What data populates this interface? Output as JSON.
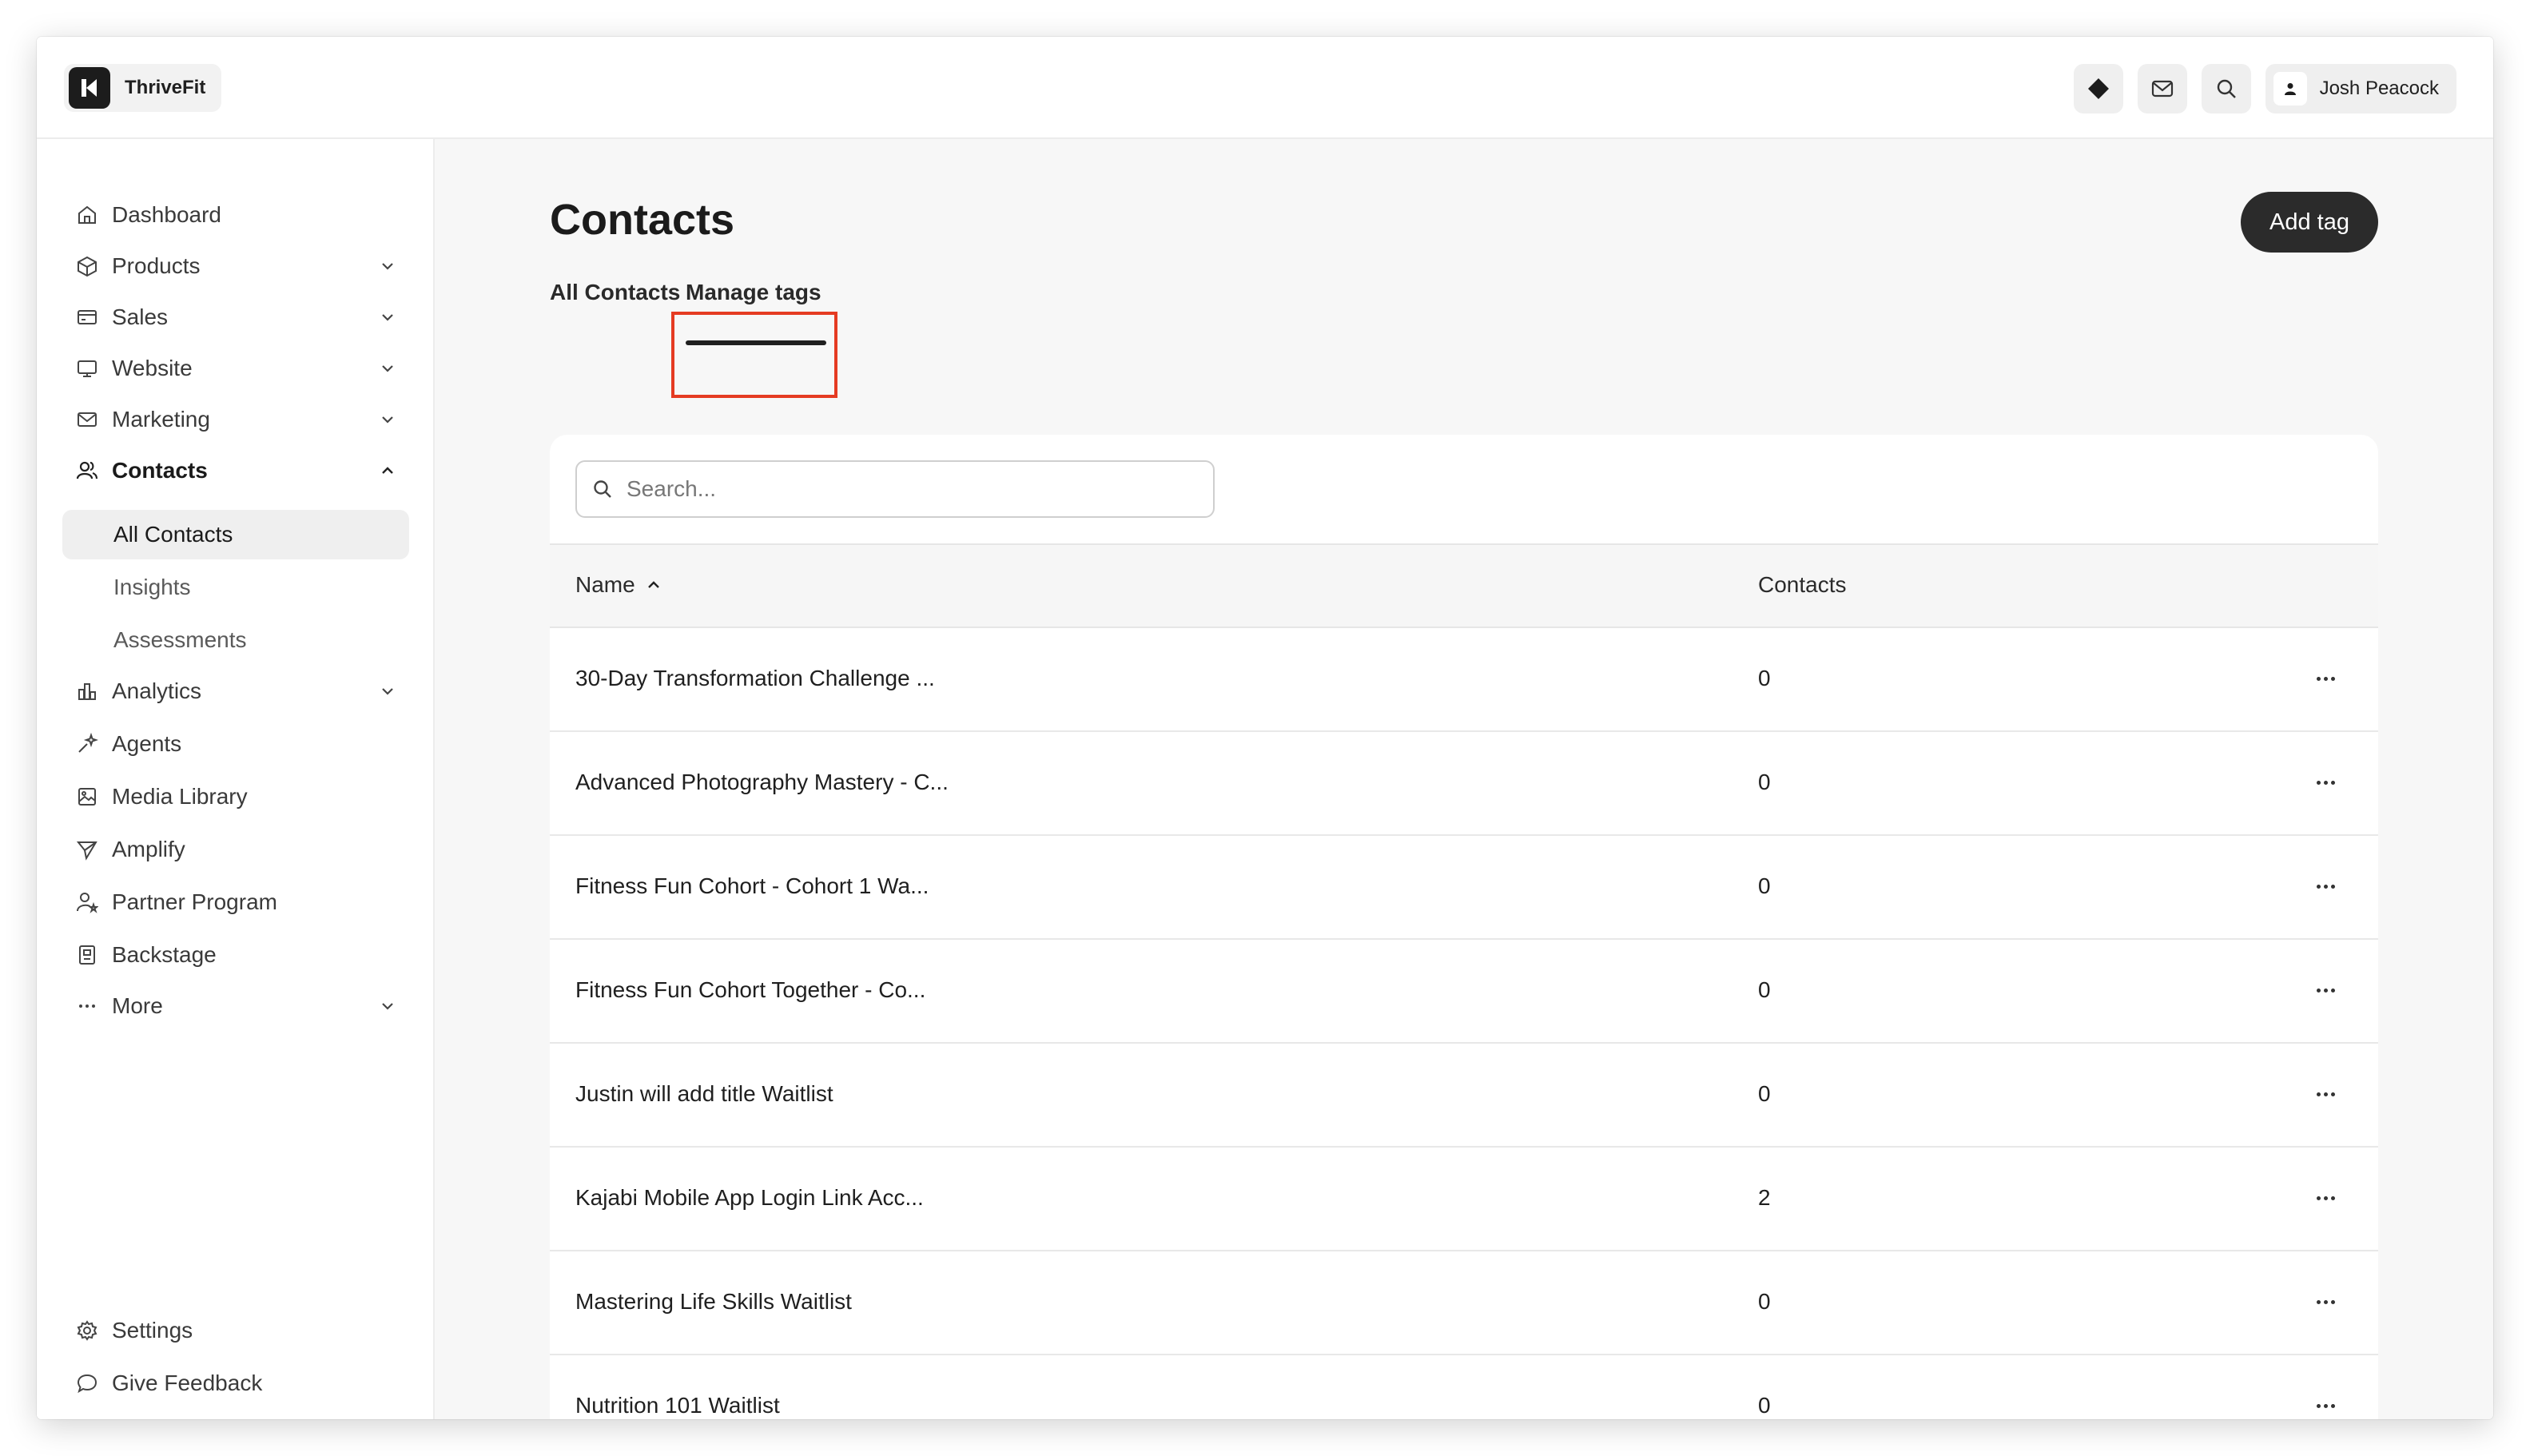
{
  "app": {
    "name": "ThriveFit"
  },
  "topbar": {
    "user_name": "Josh Peacock",
    "icons": [
      "diamond-icon",
      "mail-icon",
      "search-icon",
      "user-icon"
    ]
  },
  "sidebar": {
    "items": [
      {
        "label": "Dashboard",
        "icon": "home-icon"
      },
      {
        "label": "Products",
        "icon": "box-icon"
      },
      {
        "label": "Sales",
        "icon": "credit-card-icon"
      },
      {
        "label": "Website",
        "icon": "monitor-icon"
      },
      {
        "label": "Marketing",
        "icon": "mail-icon"
      },
      {
        "label": "Contacts",
        "icon": "users-icon"
      },
      {
        "label": "Analytics",
        "icon": "bar-chart-icon"
      },
      {
        "label": "Agents",
        "icon": "sparkle-icon"
      },
      {
        "label": "Media Library",
        "icon": "image-icon"
      },
      {
        "label": "Amplify",
        "icon": "send-icon"
      },
      {
        "label": "Partner Program",
        "icon": "user-star-icon"
      },
      {
        "label": "Backstage",
        "icon": "badge-icon"
      },
      {
        "label": "More",
        "icon": "dots-icon"
      }
    ],
    "contacts_sub": [
      {
        "label": "All Contacts",
        "active": true
      },
      {
        "label": "Insights"
      },
      {
        "label": "Assessments"
      }
    ],
    "footer": [
      {
        "label": "Settings",
        "icon": "gear-icon"
      },
      {
        "label": "Give Feedback",
        "icon": "message-icon"
      }
    ]
  },
  "main": {
    "title": "Contacts",
    "add_button": "Add tag",
    "tabs": [
      {
        "label": "All Contacts"
      },
      {
        "label": "Manage tags",
        "active": true
      }
    ],
    "search_placeholder": "Search...",
    "columns": {
      "name": "Name",
      "contacts": "Contacts"
    },
    "rows": [
      {
        "name": "30-Day Transformation Challenge ...",
        "contacts": "0"
      },
      {
        "name": "Advanced Photography Mastery - C...",
        "contacts": "0"
      },
      {
        "name": "Fitness Fun Cohort - Cohort 1 Wa...",
        "contacts": "0"
      },
      {
        "name": "Fitness Fun Cohort Together - Co...",
        "contacts": "0"
      },
      {
        "name": "Justin will add title Waitlist",
        "contacts": "0"
      },
      {
        "name": "Kajabi Mobile App Login Link Acc...",
        "contacts": "2"
      },
      {
        "name": "Mastering Life Skills Waitlist",
        "contacts": "0"
      },
      {
        "name": "Nutrition 101 Waitlist",
        "contacts": "0"
      }
    ]
  },
  "colors": {
    "highlight": "#e53b22",
    "button_dark": "#2b2b2b"
  }
}
